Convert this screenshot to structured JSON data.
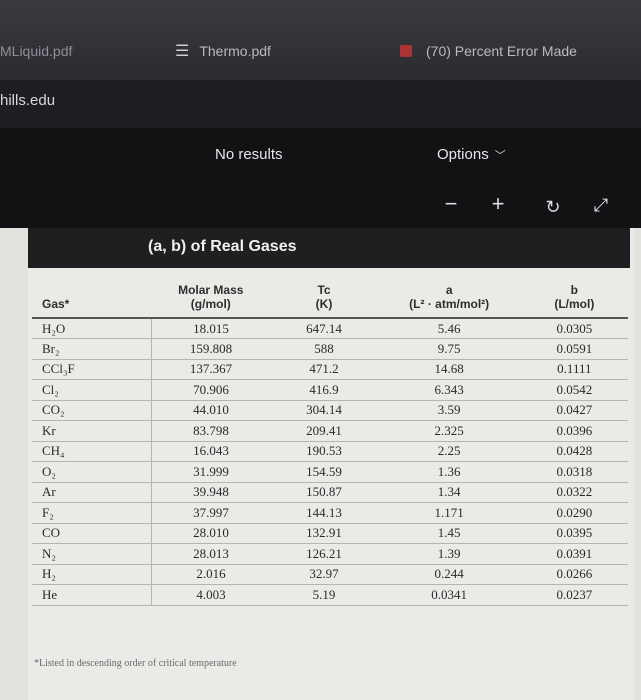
{
  "tabs": [
    {
      "label": "MLiquid.pdf"
    },
    {
      "label": "Thermo.pdf"
    },
    {
      "label": "(70) Percent Error Made"
    }
  ],
  "address": {
    "text": "hills.edu"
  },
  "viewer": {
    "find_status": "No results",
    "options_label": "Options",
    "zoom_out_glyph": "−",
    "zoom_in_glyph": "+",
    "rotate_glyph": "↻",
    "expand_glyph": "⤢"
  },
  "table": {
    "title": "(a, b) of Real Gases",
    "headers": {
      "gas": "Gas*",
      "molar_mass": "Molar Mass",
      "molar_mass_unit": "(g/mol)",
      "tc": "Tc",
      "tc_unit": "(K)",
      "a": "a",
      "a_unit": "(L² · atm/mol²)",
      "b": "b",
      "b_unit": "(L/mol)"
    },
    "rows": [
      {
        "gas": "H₂O",
        "molar_mass": "18.015",
        "tc": "647.14",
        "a": "5.46",
        "b": "0.0305"
      },
      {
        "gas": "Br₂",
        "molar_mass": "159.808",
        "tc": "588",
        "a": "9.75",
        "b": "0.0591"
      },
      {
        "gas": "CCl₃F",
        "molar_mass": "137.367",
        "tc": "471.2",
        "a": "14.68",
        "b": "0.1111"
      },
      {
        "gas": "Cl₂",
        "molar_mass": "70.906",
        "tc": "416.9",
        "a": "6.343",
        "b": "0.0542"
      },
      {
        "gas": "CO₂",
        "molar_mass": "44.010",
        "tc": "304.14",
        "a": "3.59",
        "b": "0.0427"
      },
      {
        "gas": "Kr",
        "molar_mass": "83.798",
        "tc": "209.41",
        "a": "2.325",
        "b": "0.0396"
      },
      {
        "gas": "CH₄",
        "molar_mass": "16.043",
        "tc": "190.53",
        "a": "2.25",
        "b": "0.0428"
      },
      {
        "gas": "O₂",
        "molar_mass": "31.999",
        "tc": "154.59",
        "a": "1.36",
        "b": "0.0318"
      },
      {
        "gas": "Ar",
        "molar_mass": "39.948",
        "tc": "150.87",
        "a": "1.34",
        "b": "0.0322"
      },
      {
        "gas": "F₂",
        "molar_mass": "37.997",
        "tc": "144.13",
        "a": "1.171",
        "b": "0.0290"
      },
      {
        "gas": "CO",
        "molar_mass": "28.010",
        "tc": "132.91",
        "a": "1.45",
        "b": "0.0395"
      },
      {
        "gas": "N₂",
        "molar_mass": "28.013",
        "tc": "126.21",
        "a": "1.39",
        "b": "0.0391"
      },
      {
        "gas": "H₂",
        "molar_mass": "2.016",
        "tc": "32.97",
        "a": "0.244",
        "b": "0.0266"
      },
      {
        "gas": "He",
        "molar_mass": "4.003",
        "tc": "5.19",
        "a": "0.0341",
        "b": "0.0237"
      }
    ],
    "footnote": "*Listed in descending order of critical temperature"
  }
}
